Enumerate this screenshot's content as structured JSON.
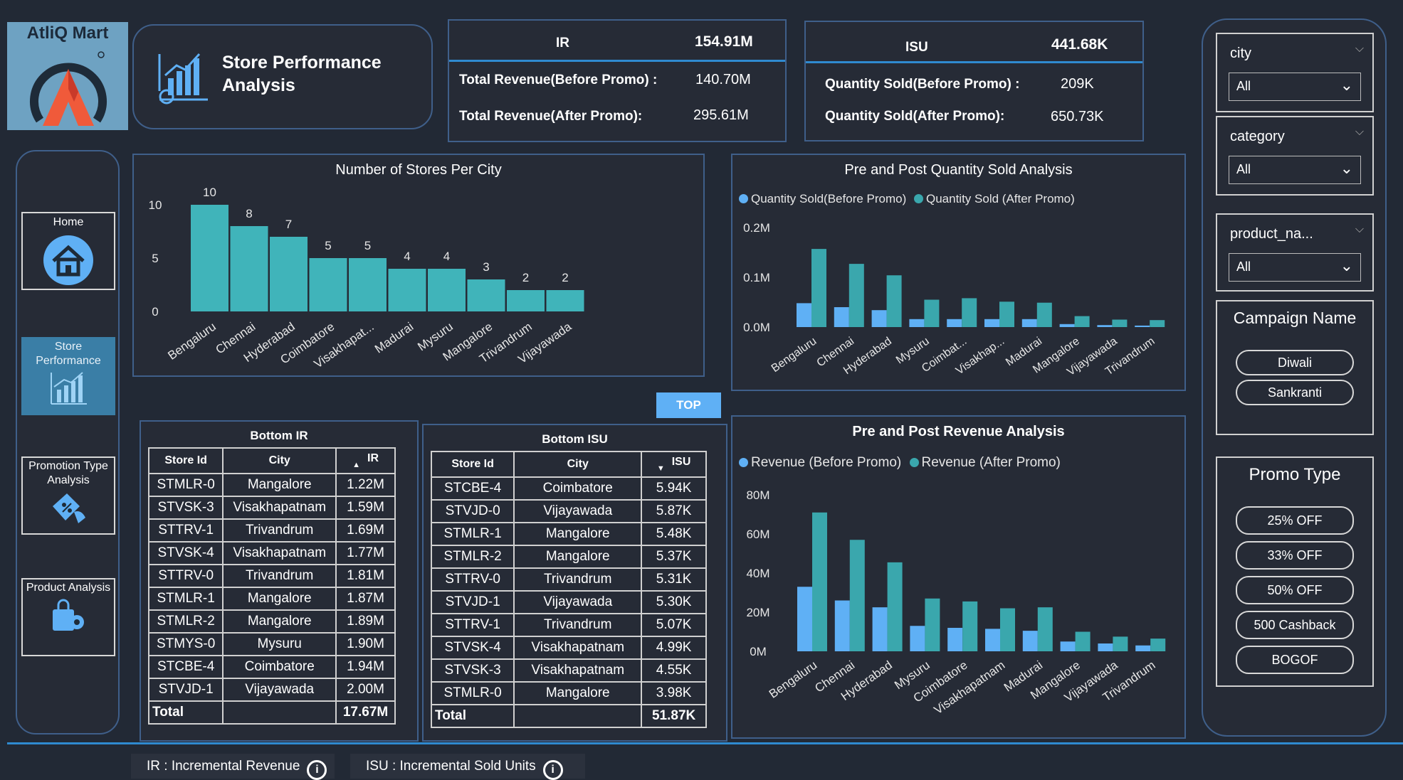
{
  "brand": {
    "name": "AtliQ Mart"
  },
  "header": {
    "title": "Store Performance Analysis"
  },
  "kpi_ir": {
    "label": "IR",
    "value": "154.91M",
    "before_label": "Total Revenue(Before Promo) :",
    "before_value": "140.70M",
    "after_label": "Total Revenue(After Promo):",
    "after_value": "295.61M"
  },
  "kpi_isu": {
    "label": "ISU",
    "value": "441.68K",
    "before_label": "Quantity Sold(Before Promo) :",
    "before_value": "209K",
    "after_label": "Quantity Sold(After Promo):",
    "after_value": "650.73K"
  },
  "nav": {
    "items": [
      {
        "label": "Home",
        "icon": "home-icon"
      },
      {
        "label": "Store Performance",
        "icon": "chart-icon",
        "active": true
      },
      {
        "label": "Promotion Type Analysis",
        "icon": "discount-icon"
      },
      {
        "label": "Product Analysis",
        "icon": "product-icon"
      }
    ]
  },
  "top_button": {
    "label": "TOP"
  },
  "stores_chart": {
    "title": "Number of Stores Per City",
    "chart_data": {
      "type": "bar",
      "categories": [
        "Bengaluru",
        "Chennai",
        "Hyderabad",
        "Coimbatore",
        "Visakhapat...",
        "Madurai",
        "Mysuru",
        "Mangalore",
        "Trivandrum",
        "Vijayawada"
      ],
      "values": [
        10,
        8,
        7,
        5,
        5,
        4,
        4,
        3,
        2,
        2
      ],
      "yticks": [
        "0",
        "5",
        "10"
      ],
      "ylim": [
        0,
        10
      ],
      "color": "#40b4ba"
    }
  },
  "qty_chart": {
    "title": "Pre and Post Quantity Sold Analysis",
    "chart_data": {
      "type": "bar",
      "categories": [
        "Bengaluru",
        "Chennai",
        "Hyderabad",
        "Mysuru",
        "Coimbat...",
        "Visakhap...",
        "Madurai",
        "Mangalore",
        "Vijayawada",
        "Trivandrum"
      ],
      "series": [
        {
          "name": "Quantity Sold(Before Promo)",
          "color": "#5fb0f5",
          "values": [
            0.048,
            0.04,
            0.034,
            0.016,
            0.016,
            0.016,
            0.016,
            0.006,
            0.004,
            0.003
          ]
        },
        {
          "name": "Quantity Sold (After Promo)",
          "color": "#3aa7ad",
          "values": [
            0.157,
            0.127,
            0.104,
            0.055,
            0.058,
            0.051,
            0.049,
            0.022,
            0.015,
            0.014
          ]
        }
      ],
      "yticks": [
        "0.0M",
        "0.1M",
        "0.2M"
      ],
      "ylim": [
        0,
        0.2
      ]
    }
  },
  "rev_chart": {
    "title": "Pre and Post Revenue Analysis",
    "chart_data": {
      "type": "bar",
      "categories": [
        "Bengaluru",
        "Chennai",
        "Hyderabad",
        "Mysuru",
        "Coimbatore",
        "Visakhapatnam",
        "Madurai",
        "Mangalore",
        "Vijayawada",
        "Trivandrum"
      ],
      "series": [
        {
          "name": "Revenue (Before Promo)",
          "color": "#5fb0f5",
          "values": [
            33,
            26,
            22.5,
            13,
            12,
            11.5,
            10.5,
            5,
            4,
            3
          ]
        },
        {
          "name": "Revenue (After Promo)",
          "color": "#3aa7ad",
          "values": [
            71,
            57,
            45.5,
            27,
            25.5,
            22,
            22.5,
            10,
            7.5,
            6.5
          ]
        }
      ],
      "yticks": [
        "0M",
        "20M",
        "40M",
        "60M",
        "80M"
      ],
      "ylim": [
        0,
        80
      ]
    }
  },
  "bottom_ir": {
    "title": "Bottom IR",
    "headers": [
      "Store Id",
      "City",
      "IR"
    ],
    "rows": [
      [
        "STMLR-0",
        "Mangalore",
        "1.22M"
      ],
      [
        "STVSK-3",
        "Visakhapatnam",
        "1.59M"
      ],
      [
        "STTRV-1",
        "Trivandrum",
        "1.69M"
      ],
      [
        "STVSK-4",
        "Visakhapatnam",
        "1.77M"
      ],
      [
        "STTRV-0",
        "Trivandrum",
        "1.81M"
      ],
      [
        "STMLR-1",
        "Mangalore",
        "1.87M"
      ],
      [
        "STMLR-2",
        "Mangalore",
        "1.89M"
      ],
      [
        "STMYS-0",
        "Mysuru",
        "1.90M"
      ],
      [
        "STCBE-4",
        "Coimbatore",
        "1.94M"
      ],
      [
        "STVJD-1",
        "Vijayawada",
        "2.00M"
      ]
    ],
    "total_label": "Total",
    "total_value": "17.67M"
  },
  "bottom_isu": {
    "title": "Bottom ISU",
    "headers": [
      "Store Id",
      "City",
      "ISU"
    ],
    "rows": [
      [
        "STCBE-4",
        "Coimbatore",
        "5.94K"
      ],
      [
        "STVJD-0",
        "Vijayawada",
        "5.87K"
      ],
      [
        "STMLR-1",
        "Mangalore",
        "5.48K"
      ],
      [
        "STMLR-2",
        "Mangalore",
        "5.37K"
      ],
      [
        "STTRV-0",
        "Trivandrum",
        "5.31K"
      ],
      [
        "STVJD-1",
        "Vijayawada",
        "5.30K"
      ],
      [
        "STTRV-1",
        "Trivandrum",
        "5.07K"
      ],
      [
        "STVSK-4",
        "Visakhapatnam",
        "4.99K"
      ],
      [
        "STVSK-3",
        "Visakhapatnam",
        "4.55K"
      ],
      [
        "STMLR-0",
        "Mangalore",
        "3.98K"
      ]
    ],
    "total_label": "Total",
    "total_value": "51.87K"
  },
  "slicers": {
    "city": {
      "label": "city",
      "value": "All"
    },
    "category": {
      "label": "category",
      "value": "All"
    },
    "product": {
      "label": "product_na...",
      "value": "All"
    }
  },
  "campaign": {
    "title": "Campaign Name",
    "options": [
      "Diwali",
      "Sankranti"
    ]
  },
  "promo": {
    "title": "Promo Type",
    "options": [
      "25% OFF",
      "33% OFF",
      "50% OFF",
      "500 Cashback",
      "BOGOF"
    ]
  },
  "footer": {
    "ir_note": "IR : Incremental Revenue",
    "isu_note": "ISU : Incremental Sold Units",
    "info_glyph": "i"
  }
}
